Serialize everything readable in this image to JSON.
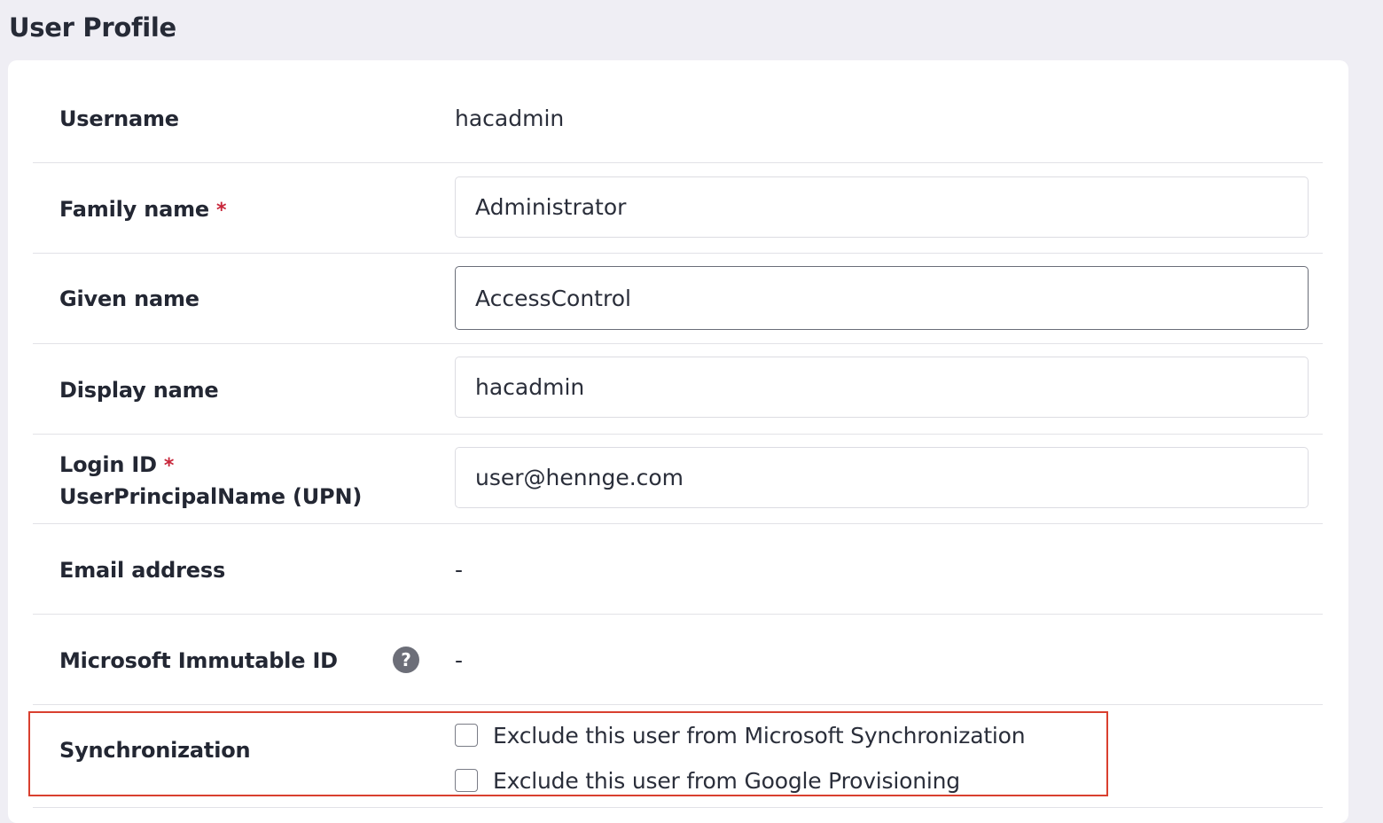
{
  "page": {
    "title": "User Profile"
  },
  "fields": {
    "username": {
      "label": "Username",
      "value": "hacadmin"
    },
    "family_name": {
      "label": "Family name",
      "required_mark": "*",
      "value": "Administrator"
    },
    "given_name": {
      "label": "Given name",
      "value": "AccessControl"
    },
    "display_name": {
      "label": "Display name",
      "value": "hacadmin"
    },
    "login_id": {
      "label": "Login ID",
      "required_mark": "*",
      "sublabel": "UserPrincipalName (UPN)",
      "value": "user@hennge.com"
    },
    "email_address": {
      "label": "Email address",
      "value": "-"
    },
    "immutable_id": {
      "label": "Microsoft Immutable ID",
      "help_icon": "?",
      "value": "-"
    },
    "synchronization": {
      "label": "Synchronization",
      "options": [
        {
          "label": "Exclude this user from Microsoft Synchronization",
          "checked": false
        },
        {
          "label": "Exclude this user from Google Provisioning",
          "checked": false
        }
      ]
    }
  },
  "colors": {
    "background": "#efeef4",
    "card": "#ffffff",
    "required": "#c8263a",
    "highlight_border": "#d9402f",
    "help_icon": "#6c6e78"
  }
}
